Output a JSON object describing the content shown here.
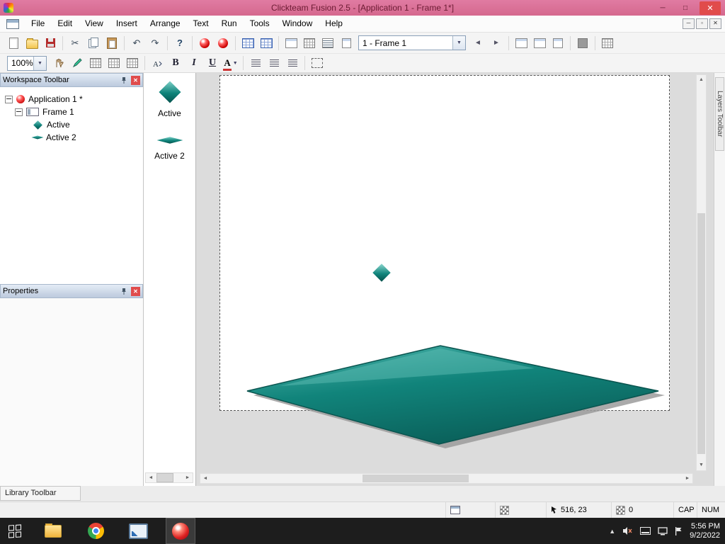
{
  "titlebar": {
    "title": "Clickteam Fusion 2.5 - [Application 1 - Frame 1*]",
    "minimize_glyph": "─",
    "maximize_glyph": "□",
    "close_glyph": "✕"
  },
  "menubar": {
    "items": [
      "File",
      "Edit",
      "View",
      "Insert",
      "Arrange",
      "Text",
      "Run",
      "Tools",
      "Window",
      "Help"
    ],
    "mdi_minimize_glyph": "─",
    "mdi_restore_glyph": "▫",
    "mdi_close_glyph": "✕"
  },
  "toolbar_main": {
    "frame_selector_value": "1 - Frame 1",
    "cut_glyph": "✂",
    "undo_glyph": "↶",
    "redo_glyph": "↷",
    "help_glyph": "?",
    "prev_glyph": "◄",
    "next_glyph": "►",
    "dropdown_glyph": "▼"
  },
  "toolbar_format": {
    "zoom_value": "100%",
    "dropdown_glyph": "▼",
    "bold_glyph": "B",
    "italic_glyph": "I",
    "underline_glyph": "U",
    "color_glyph": "A"
  },
  "workspace_panel": {
    "title": "Workspace Toolbar",
    "close_glyph": "✕",
    "tree": [
      {
        "label": "Application 1 *"
      },
      {
        "label": "Frame 1"
      },
      {
        "label": "Active"
      },
      {
        "label": "Active 2"
      }
    ]
  },
  "properties_panel": {
    "title": "Properties",
    "close_glyph": "✕"
  },
  "objects_panel": {
    "items": [
      {
        "label": "Active"
      },
      {
        "label": "Active 2"
      }
    ]
  },
  "layers_panel": {
    "title": "Layers Toolbar"
  },
  "library_panel": {
    "title": "Library Toolbar"
  },
  "statusbar": {
    "coords": "516, 23",
    "counter": "0",
    "cap_label": "CAP",
    "num_label": "NUM"
  },
  "taskbar": {
    "time": "5:56 PM",
    "date": "9/2/2022",
    "hidden_icons_glyph": "▲"
  },
  "scrollbars": {
    "left": "◄",
    "right": "►",
    "up": "▲",
    "down": "▼"
  },
  "colors": {
    "titlebar": "#d96f95",
    "close_button": "#e14b4b",
    "accent_teal": "#12857c",
    "taskbar_bg": "#1d1d1d"
  }
}
